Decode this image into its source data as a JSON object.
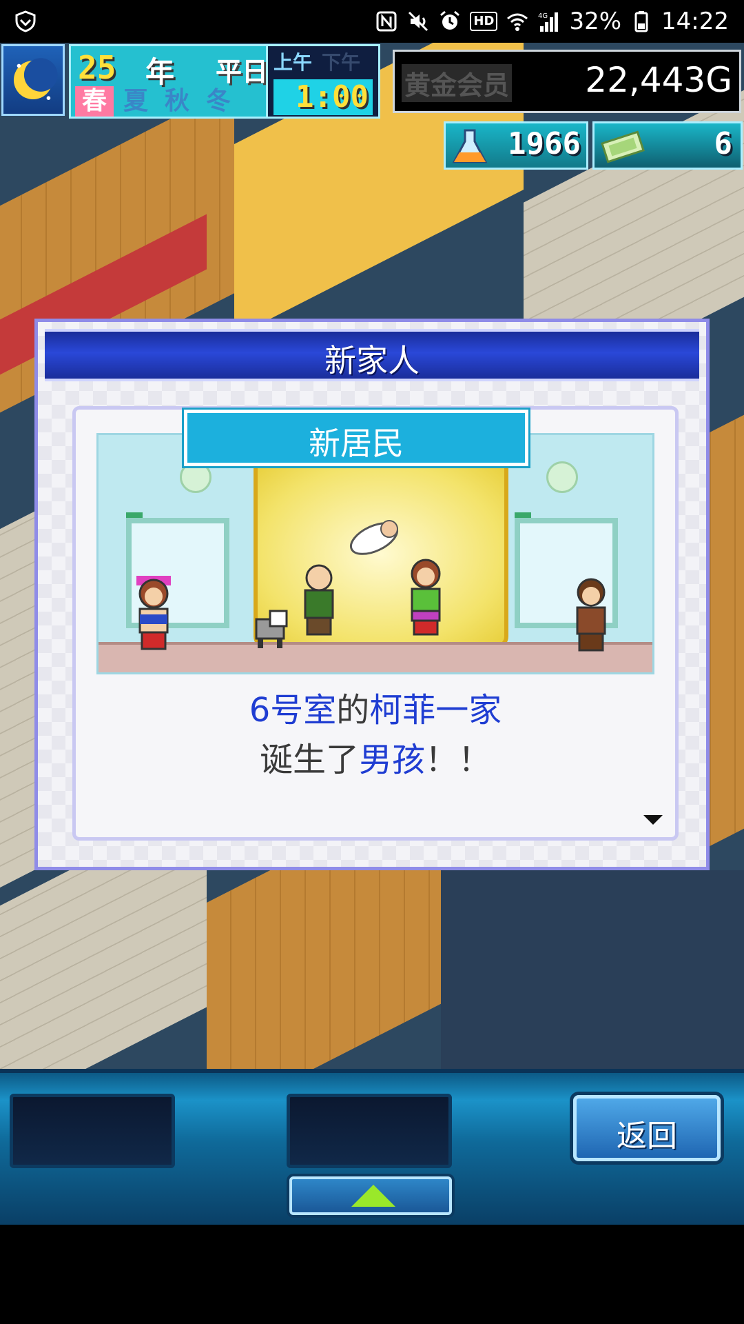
{
  "status_bar": {
    "battery": "32%",
    "time": "14:22",
    "hd_label": "HD",
    "network_label": "4G"
  },
  "hud": {
    "year_number": "25",
    "year_unit": "年",
    "day_type": "平日",
    "am_label": "上午",
    "pm_label": "下午",
    "clock": "1:00",
    "seasons": [
      "春",
      "夏",
      "秋",
      "冬"
    ],
    "active_season": "春",
    "member_label": "黄金会员",
    "money": "22,443G",
    "research_points": "1966",
    "tickets": "6"
  },
  "dialog": {
    "title": "新家人",
    "banner": "新居民",
    "message_line1": {
      "part1": "6号室",
      "part2": "的",
      "part3": "柯菲一家"
    },
    "message_line2": {
      "part1": "诞生了",
      "part2": "男孩",
      "part3": "！！"
    }
  },
  "bottom_bar": {
    "back_label": "返回"
  },
  "colors": {
    "highlight": "#1f3dd2",
    "dialog_header": "#1a2d9a",
    "banner": "#1cb0dd",
    "gold": "#ffe03a"
  },
  "icons": [
    "shield-icon",
    "nfc-icon",
    "mute-icon",
    "alarm-icon",
    "wifi-icon",
    "signal-icon",
    "battery-icon",
    "moon-icon",
    "flask-icon",
    "ticket-icon",
    "up-arrow-icon",
    "next-arrow-icon"
  ]
}
